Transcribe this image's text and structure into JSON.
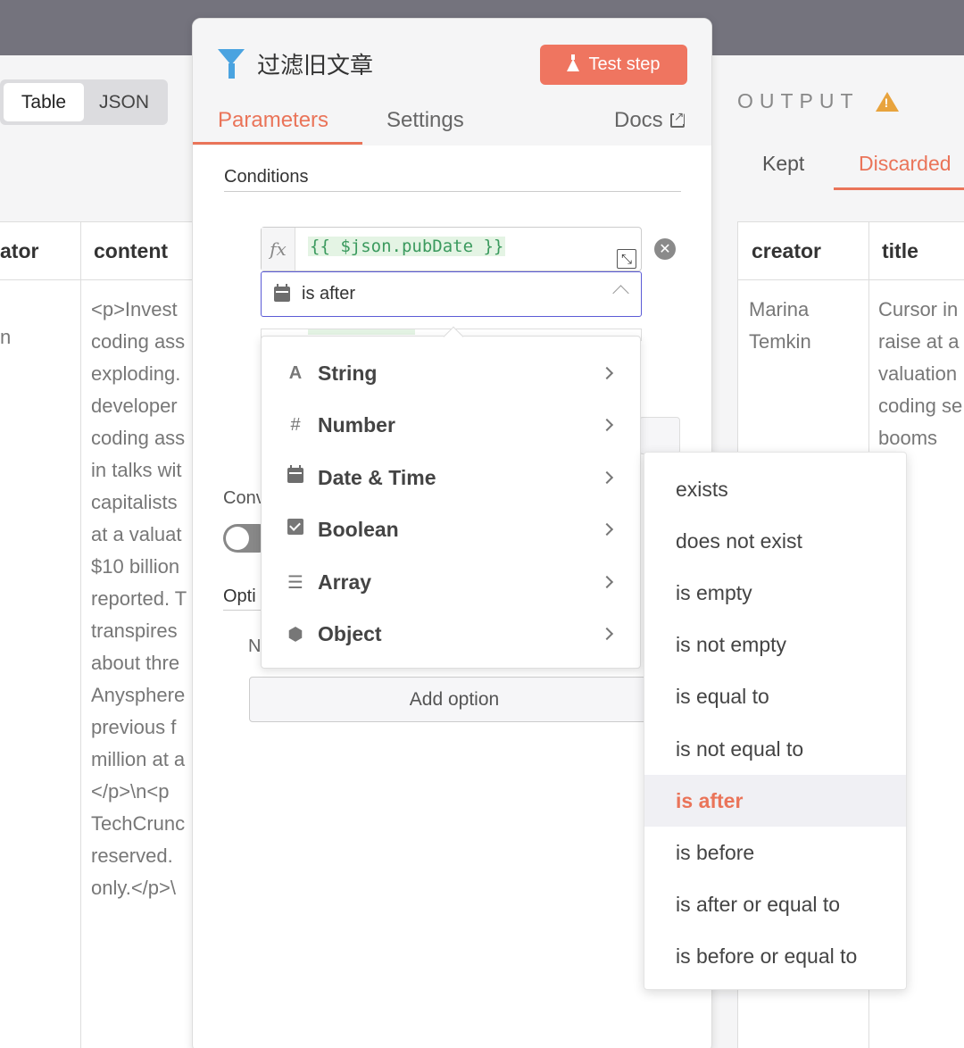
{
  "input_panel": {
    "view_toggle": {
      "table_label": "Table",
      "json_label": "JSON"
    },
    "columns": [
      "ator",
      "content"
    ],
    "cut_marker": "n",
    "content_lines": [
      "<p>Invest",
      "coding ass",
      "exploding.",
      "developer",
      "coding ass",
      "in talks wit",
      "capitalists",
      "at a valuat",
      "$10 billion",
      "reported. T",
      "transpires",
      "about thre",
      "Anysphere",
      "previous f",
      "million at a",
      "</p>\\n<p",
      "TechCrunc",
      "reserved.",
      "only.</p>\\"
    ]
  },
  "node": {
    "title": "过滤旧文章",
    "test_step_label": "Test step",
    "tabs": {
      "parameters": "Parameters",
      "settings": "Settings",
      "docs": "Docs"
    },
    "conditions_label": "Conditions",
    "condition": {
      "fx_label": "fx",
      "left_value": "{{ $json.pubDate }}",
      "operator": "is after"
    },
    "convert_label": "Conv",
    "options_label": "Opti",
    "n_label": "N",
    "add_option_label": "Add option"
  },
  "type_menu": [
    {
      "icon": "A",
      "label": "String"
    },
    {
      "icon": "#",
      "label": "Number"
    },
    {
      "icon": "calendar",
      "label": "Date & Time"
    },
    {
      "icon": "check",
      "label": "Boolean"
    },
    {
      "icon": "list",
      "label": "Array"
    },
    {
      "icon": "cube",
      "label": "Object"
    }
  ],
  "operator_menu": [
    {
      "label": "exists",
      "selected": false
    },
    {
      "label": "does not exist",
      "selected": false
    },
    {
      "label": "is empty",
      "selected": false
    },
    {
      "label": "is not empty",
      "selected": false
    },
    {
      "label": "is equal to",
      "selected": false
    },
    {
      "label": "is not equal to",
      "selected": false
    },
    {
      "label": "is after",
      "selected": true
    },
    {
      "label": "is before",
      "selected": false
    },
    {
      "label": "is after or equal to",
      "selected": false
    },
    {
      "label": "is before or equal to",
      "selected": false
    }
  ],
  "output_panel": {
    "title": "OUTPUT",
    "tabs": {
      "kept": "Kept",
      "discarded": "Discarded"
    },
    "columns": [
      "creator",
      "title"
    ],
    "creator_lines": [
      "Marina",
      "Temkin"
    ],
    "title_lines": [
      "Cursor in",
      "raise at a",
      "valuation",
      "coding se",
      "booms"
    ]
  },
  "colors": {
    "accent": "#ea7459",
    "focus": "#5b5bd6",
    "expression_green": "#3b9a5e",
    "warning": "#e8a33d",
    "filter_icon": "#4aa3e0"
  }
}
